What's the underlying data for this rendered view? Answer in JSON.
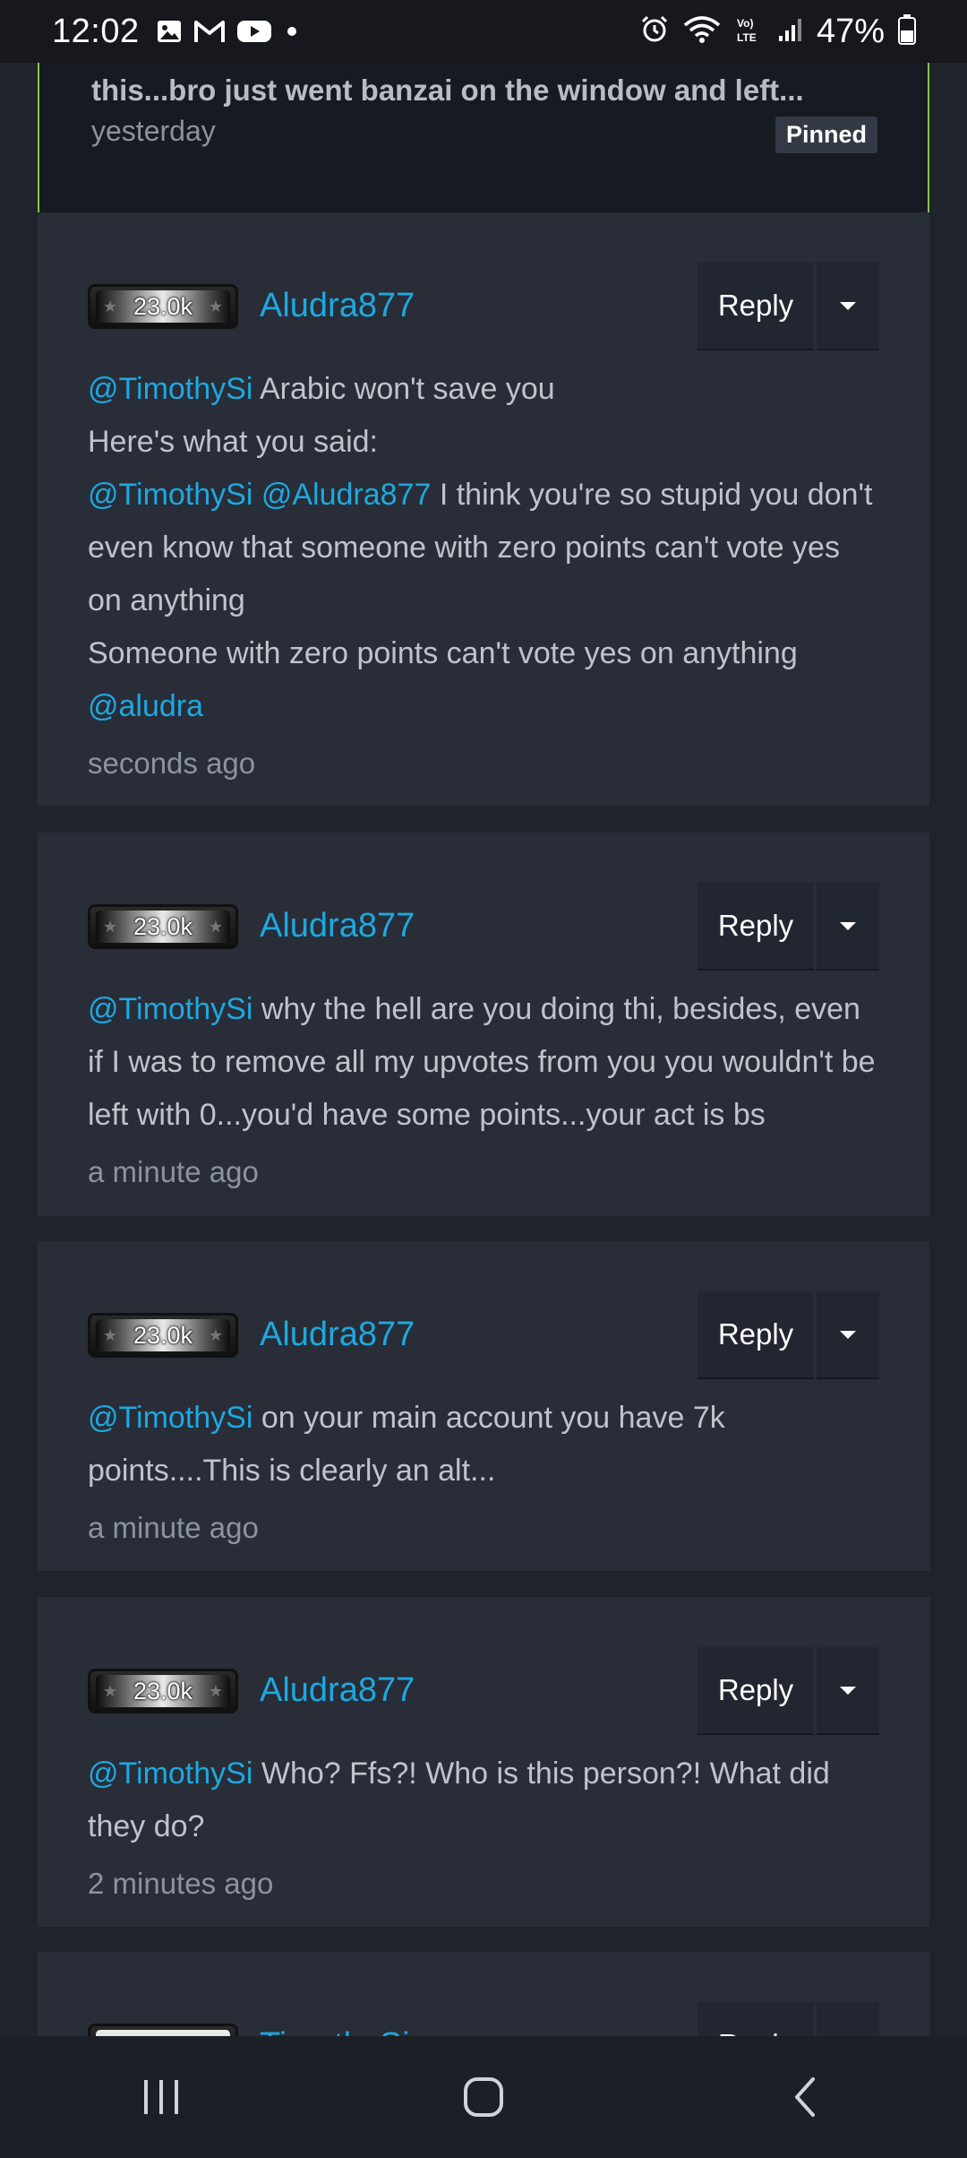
{
  "status_bar": {
    "time": "12:02",
    "left_icons": [
      "gallery-icon",
      "gmail-icon",
      "youtube-icon",
      "dot-icon"
    ],
    "right_icons": [
      "alarm-icon",
      "wifi-icon",
      "volte-icon",
      "signal-icon",
      "battery-icon"
    ],
    "battery": "47%"
  },
  "pinned": {
    "text": "this...bro just went banzai on the window and left...",
    "time": "yesterday",
    "badge": "Pinned",
    "border_color": "#8bc34a"
  },
  "comments": [
    {
      "rank": "23.0k",
      "username": "Aludra877",
      "reply_label": "Reply",
      "lines": [
        {
          "mention": "@TimothySi",
          "text": " Arabic won't save you"
        },
        {
          "mention": "",
          "text": "Here's what you said:"
        },
        {
          "mention": "@TimothySi @Aludra877",
          "text": " I think you're so stupid you don't even know that someone with zero points can't vote yes on anything"
        },
        {
          "mention": "",
          "text": "Someone with zero points can't vote yes on anything"
        },
        {
          "mention": "@aludra",
          "text": ""
        }
      ],
      "time": "seconds ago"
    },
    {
      "rank": "23.0k",
      "username": "Aludra877",
      "reply_label": "Reply",
      "lines": [
        {
          "mention": "@TimothySi",
          "text": " why the hell are you doing thi, besides, even if I was to remove all my upvotes from you you wouldn't be left with 0...you'd have some points...your act is bs"
        }
      ],
      "time": "a minute ago"
    },
    {
      "rank": "23.0k",
      "username": "Aludra877",
      "reply_label": "Reply",
      "lines": [
        {
          "mention": "@TimothySi",
          "text": " on your main account you have 7k points....This is clearly an alt..."
        }
      ],
      "time": "a minute ago"
    },
    {
      "rank": "23.0k",
      "username": "Aludra877",
      "reply_label": "Reply",
      "lines": [
        {
          "mention": "@TimothySi",
          "text": " Who? Ffs?! Who is this person?! What did they do?"
        }
      ],
      "time": "2 minutes ago"
    },
    {
      "rank": "",
      "username": "TimothySi",
      "reply_label": "Reply",
      "lines": [],
      "time": ""
    }
  ],
  "nav_bar": {
    "buttons": [
      "recents-icon",
      "home-icon",
      "back-icon"
    ]
  },
  "colors": {
    "accent": "#1ea8e0",
    "card_bg": "#282d37",
    "page_bg": "#1f232b"
  }
}
